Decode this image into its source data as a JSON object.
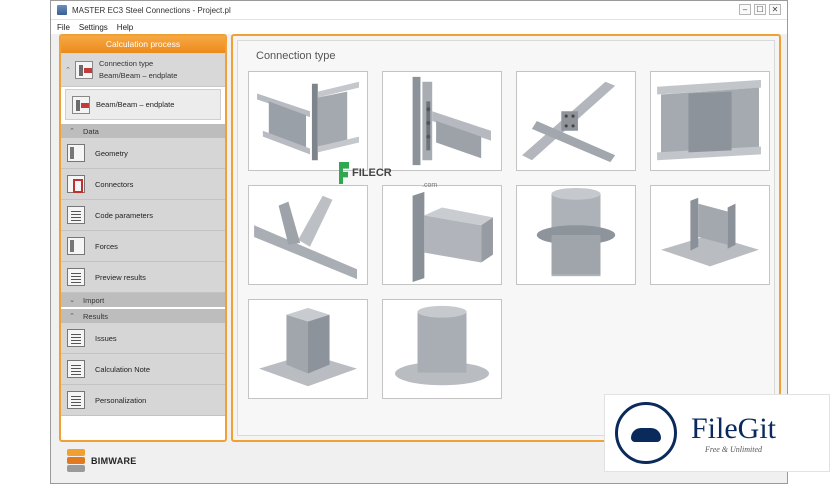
{
  "window": {
    "title": "MASTER EC3 Steel Connections - Project.pl",
    "controls": [
      "–",
      "☐",
      "✕"
    ]
  },
  "menu": [
    "File",
    "Settings",
    "Help"
  ],
  "left_panel": {
    "header": "Calculation process",
    "step": {
      "title": "Connection type",
      "subtitle": "Beam/Beam – endplate"
    },
    "selected": "Beam/Beam – endplate",
    "data_section": "Data",
    "data_items": [
      "Geometry",
      "Connectors",
      "Code parameters",
      "Forces",
      "Preview results"
    ],
    "import_section": "Import",
    "results_section": "Results",
    "results_items": [
      "Issues",
      "Calculation Note",
      "Personalization"
    ]
  },
  "main": {
    "title": "Connection type",
    "tiles": [
      "i-beam-to-i-beam-endplate",
      "beam-to-column-bracket",
      "crossing-beams",
      "i-beam-bolted-splice",
      "tube-truss-node",
      "rectangular-tube-to-plate",
      "circular-tube-flange",
      "column-base-i-section",
      "column-base-rectangular-tube",
      "column-base-circular-tube"
    ]
  },
  "logo": {
    "text": "BIMWARE"
  },
  "watermark": {
    "name": "FILECR",
    "sub": ".com"
  },
  "badge": {
    "name": "FileGit",
    "tagline": "Free & Unlimited"
  },
  "colors": {
    "accent": "#f1a033",
    "steel": "#9aa0a8",
    "badge": "#0b2a5c"
  }
}
